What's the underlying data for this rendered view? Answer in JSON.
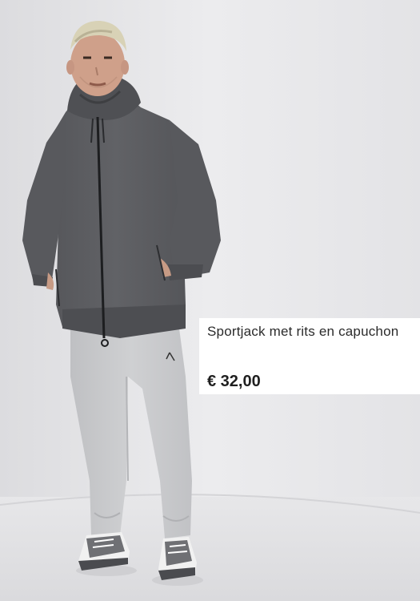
{
  "product": {
    "name": "Sportjack met rits en capuchon",
    "price": "€ 32,00",
    "image_alt": "Model in a dark grey hooded zip jacket, light grey jogging pants and grey-white sneakers"
  },
  "colors": {
    "background": "#e6e6e8",
    "card": "#ffffff",
    "jacket": "#5c5d60",
    "pants": "#c9cacc",
    "text": "#2b2b2b"
  }
}
